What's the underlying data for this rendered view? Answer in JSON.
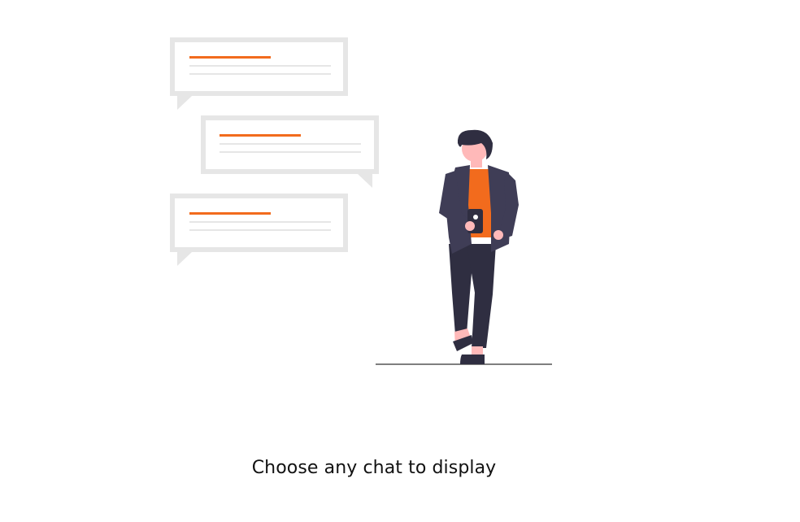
{
  "empty_state": {
    "message": "Choose any chat to display"
  },
  "illustration": {
    "accent_color": "#f26b1d",
    "bubble_color": "#e6e6e6",
    "line_color": "#e6e6e6",
    "suit_color": "#3f3d56",
    "skin_color": "#ffb9b9",
    "hair_color": "#2f2e41",
    "ground_color": "#555555"
  }
}
